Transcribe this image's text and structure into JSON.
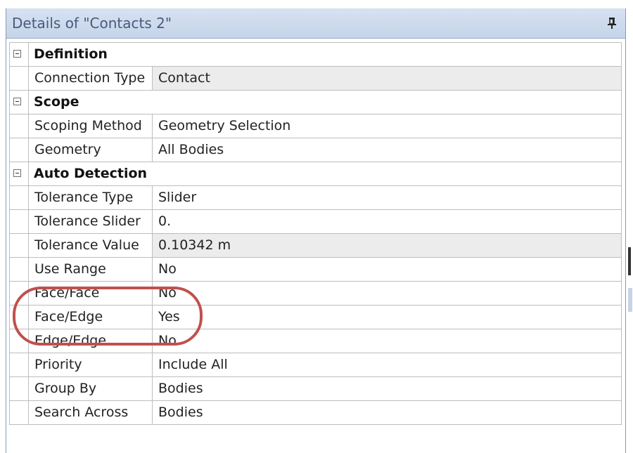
{
  "panel": {
    "title": "Details of \"Contacts 2\"",
    "pin_icon": "pin-icon"
  },
  "sections": [
    {
      "label": "Definition",
      "rows": [
        {
          "name": "Connection Type",
          "value": "Contact",
          "readonly": true
        }
      ]
    },
    {
      "label": "Scope",
      "rows": [
        {
          "name": "Scoping Method",
          "value": "Geometry Selection",
          "readonly": false
        },
        {
          "name": "Geometry",
          "value": "All Bodies",
          "readonly": false
        }
      ]
    },
    {
      "label": "Auto Detection",
      "rows": [
        {
          "name": "Tolerance Type",
          "value": "Slider",
          "readonly": false
        },
        {
          "name": "Tolerance Slider",
          "value": "0.",
          "readonly": false
        },
        {
          "name": "Tolerance Value",
          "value": "0.10342 m",
          "readonly": true
        },
        {
          "name": "Use Range",
          "value": "No",
          "readonly": false
        },
        {
          "name": "Face/Face",
          "value": "No",
          "readonly": false
        },
        {
          "name": "Face/Edge",
          "value": "Yes",
          "readonly": false
        },
        {
          "name": "Edge/Edge",
          "value": "No",
          "readonly": false
        },
        {
          "name": "Priority",
          "value": "Include All",
          "readonly": false
        },
        {
          "name": "Group By",
          "value": "Bodies",
          "readonly": false
        },
        {
          "name": "Search Across",
          "value": "Bodies",
          "readonly": false
        }
      ]
    }
  ],
  "colors": {
    "highlight_ring": "#c0504d",
    "title_bar": "#d7e2f1",
    "readonly_value_bg": "#ececec"
  }
}
